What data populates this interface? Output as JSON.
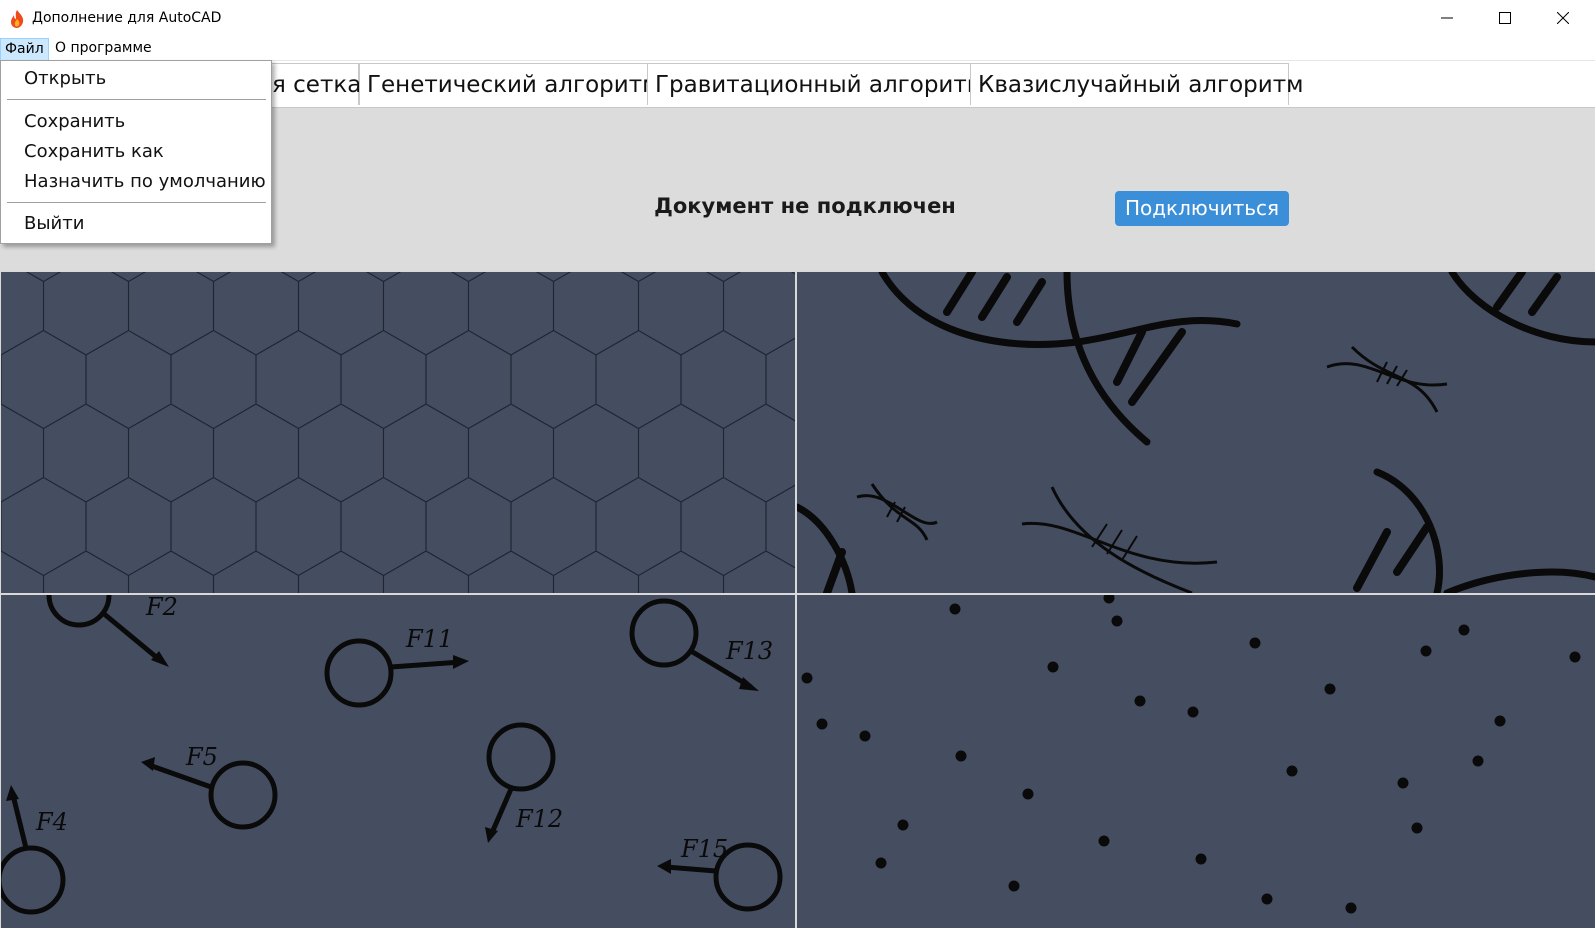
{
  "window": {
    "title": "Дополнение для AutoCAD",
    "icon": "flame-icon",
    "controls": [
      "minimize-icon",
      "maximize-icon",
      "close-icon"
    ]
  },
  "menubar": {
    "file": "Файл",
    "about": "О программе"
  },
  "tabs": [
    {
      "label": "я сетка"
    },
    {
      "label": "Генетический алгоритм"
    },
    {
      "label": "Гравитационный алгоритм"
    },
    {
      "label": "Квазислучайный алгоритм"
    }
  ],
  "status": {
    "text": "Документ не подключен",
    "connect_label": "Подключиться"
  },
  "file_menu": {
    "open": "Открыть",
    "save": "Сохранить",
    "save_as": "Сохранить как",
    "set_default": "Назначить по умолчанию",
    "exit": "Выйти"
  },
  "gravity_labels": [
    "F2",
    "F11",
    "F13",
    "F5",
    "F12",
    "F4",
    "F15"
  ],
  "colors": {
    "panel_bg": "#454e61",
    "accent": "#3b8fd9",
    "banner_bg": "#dcdcdc"
  }
}
